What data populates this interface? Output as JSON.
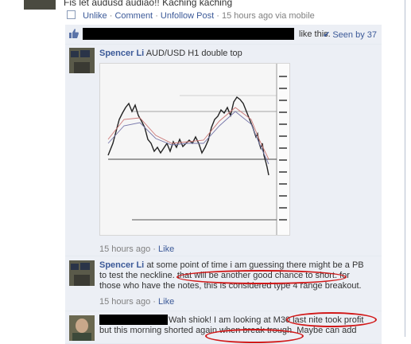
{
  "post": {
    "text": "Fis let audusd audiao!! Kaching kaching",
    "actions": {
      "unlike": "Unlike",
      "comment": "Comment",
      "unfollow": "Unfollow Post",
      "sep": "·",
      "time": "15 hours ago via mobile"
    }
  },
  "likes": {
    "suffix": "like this.",
    "seen_by": "Seen by 37"
  },
  "comments": [
    {
      "author": "Spencer Li",
      "text": "AUD/USD H1 double top",
      "time": "15 hours ago",
      "like": "Like"
    },
    {
      "author": "Spencer Li",
      "text_line1": "at some point of time i am guessing there might be a PB",
      "text_line2": "to test the neckline. that will be another good chance to short. for",
      "text_line3": "those who have the notes, this is considered type 4 range breakout.",
      "time": "15 hours ago",
      "like": "Like"
    },
    {
      "text_line1": "Wah shiok! I am looking at M30 last nite took profit",
      "text_line2": "but this morning shorted again when break trough. Maybe can add"
    }
  ],
  "colors": {
    "link": "#3b5998",
    "comment_bg": "#eceff5",
    "highlight": "#d11919"
  },
  "icons": {
    "like": "thumbs-up-icon",
    "seen": "checkmark-icon",
    "comment_bubble": "comment-icon"
  }
}
